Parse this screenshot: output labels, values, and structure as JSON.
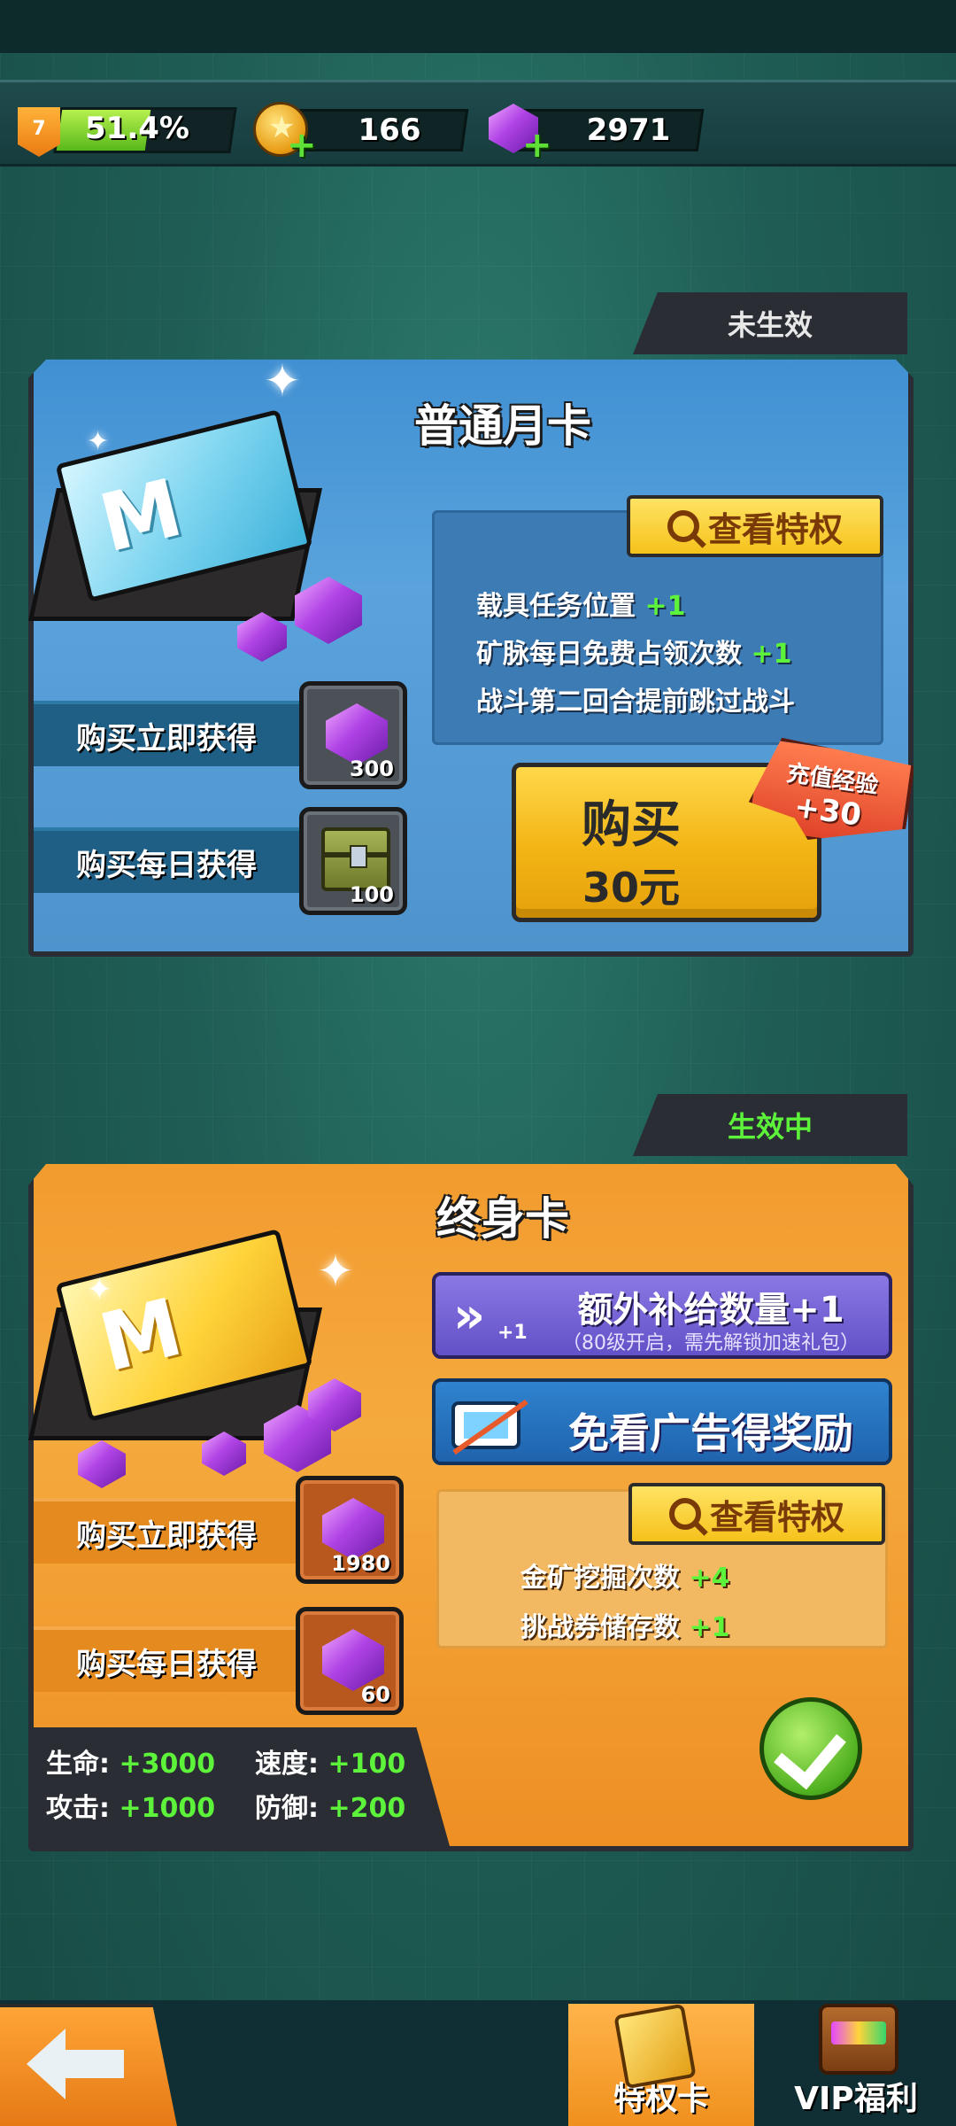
{
  "top_bar": {
    "level": "7",
    "xp_percent_text": "51.4%",
    "xp_fraction": 0.514,
    "gold": "166",
    "gems": "2971"
  },
  "card_monthly": {
    "status_tab": "未生效",
    "title": "普通月卡",
    "ticket_letter": "M",
    "instant_label": "购买立即获得",
    "instant_count": "300",
    "daily_label": "购买每日获得",
    "daily_count": "100",
    "view_perks_label": "查看特权",
    "perks": [
      {
        "text": "载具任务位置",
        "plus": "+1"
      },
      {
        "text": "矿脉每日免费占领次数",
        "plus": "+1"
      },
      {
        "text": "战斗第二回合提前跳过战斗",
        "plus": ""
      }
    ],
    "buy_label": "购买",
    "price": "30元",
    "exp_badge_title": "充值经验",
    "exp_badge_value": "+30"
  },
  "card_lifetime": {
    "status_tab": "生效中",
    "title": "终身卡",
    "ticket_letter": "M",
    "feature_supply": {
      "title": "额外补给数量+1",
      "subtitle": "（80级开启，需先解锁加速礼包）",
      "icon_plus": "+1"
    },
    "feature_no_ads": {
      "title": "免看广告得奖励"
    },
    "instant_label": "购买立即获得",
    "instant_count": "1980",
    "daily_label": "购买每日获得",
    "daily_count": "60",
    "view_perks_label": "查看特权",
    "perks": [
      {
        "text": "金矿挖掘次数",
        "plus": "+4"
      },
      {
        "text": "挑战券储存数",
        "plus": "+1"
      }
    ],
    "stats": {
      "hp_label": "生命:",
      "hp_value": "+3000",
      "speed_label": "速度:",
      "speed_value": "+100",
      "atk_label": "攻击:",
      "atk_value": "+1000",
      "def_label": "防御:",
      "def_value": "+200"
    }
  },
  "bottom_nav": {
    "privilege_card": "特权卡",
    "vip_welfare": "VIP福利"
  },
  "colors": {
    "accent_green": "#5ef33b",
    "blue_card": "#4f93cc",
    "orange_card": "#f29a2e",
    "button_yellow": "#f6c21b"
  }
}
